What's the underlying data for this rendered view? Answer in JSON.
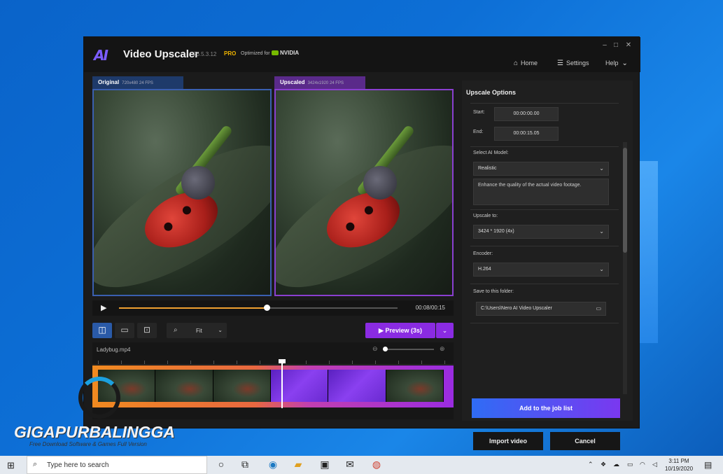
{
  "app": {
    "title": "Video Upscaler",
    "version": "26.5.3.12",
    "edition": "PRO",
    "optimized_label": "Optimized for",
    "nvidia_label": "NVIDIA"
  },
  "window_controls": {
    "minimize": "–",
    "maximize": "□",
    "close": "✕"
  },
  "nav": {
    "home": "Home",
    "settings": "Settings",
    "help": "Help"
  },
  "preview": {
    "original_label": "Original",
    "original_res": "720x480 24 FPS",
    "upscaled_label": "Upscaled",
    "upscaled_res": "3424x1920 24 FPS",
    "time": "00:08/00:15",
    "progress": 0.53
  },
  "toolbar": {
    "zoom_value": "Fit",
    "preview_button": "Preview (3s)"
  },
  "timeline": {
    "file_name": "Ladybug.mp4",
    "zoom_level": 0.0
  },
  "options": {
    "title": "Upscale Options",
    "start_label": "Start:",
    "start_value": "00:00:00.00",
    "end_label": "End:",
    "end_value": "00:00:15.05",
    "model_label": "Select AI Model:",
    "model_value": "Realistic",
    "model_desc": "Enhance the quality of the actual video footage.",
    "upscale_label": "Upscale to:",
    "upscale_value": "3424 * 1920 (4x)",
    "encoder_label": "Encoder:",
    "encoder_value": "H.264",
    "folder_label": "Save to this folder:",
    "folder_value": "C:\\Users\\Nero AI Video Upscaler",
    "add_button": "Add to the job list",
    "import_button": "Import video",
    "cancel_button": "Cancel"
  },
  "watermark": {
    "title": "GIGAPURBALINGGA",
    "subtitle": "Free Download Software & Games Full Version"
  },
  "taskbar": {
    "search_placeholder": "Type here to search",
    "time": "3:11 PM",
    "date": "10/19/2020"
  },
  "colors": {
    "accent_purple": "#8a2be2",
    "accent_blue": "#2f6cf5",
    "timeline_orange": "#f08a20"
  }
}
